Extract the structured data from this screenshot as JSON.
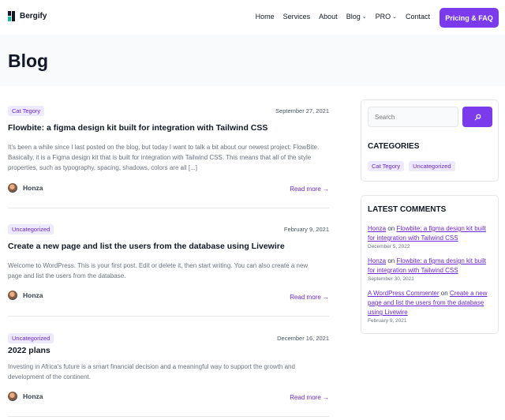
{
  "header": {
    "logo_text": "Bergify",
    "nav": [
      {
        "label": "Home",
        "has_dropdown": false
      },
      {
        "label": "Services",
        "has_dropdown": false
      },
      {
        "label": "About",
        "has_dropdown": false
      },
      {
        "label": "Blog",
        "has_dropdown": true
      },
      {
        "label": "PRO",
        "has_dropdown": true
      },
      {
        "label": "Contact",
        "has_dropdown": false
      }
    ],
    "cta_label": "Pricing & FAQ"
  },
  "page": {
    "title": "Blog"
  },
  "posts": [
    {
      "tag": "Cat Tegory",
      "date": "September 27, 2021",
      "title": "Flowbite: a figma design kit built for integration with Tailwind CSS",
      "excerpt_lines": [
        "It's been a while since I last posted on the blog, but today I want to talk a bit about our newest project: FlowBite.",
        "Basically, it is a Figma design kit that is built for integration with Tailwind CSS. This means that all of the style",
        "properties, such as typography, spacing, shadows, colors are all [...]"
      ],
      "author": "Honza",
      "read_more": "Read more →"
    },
    {
      "tag": "Uncategorized",
      "date": "February 9, 2021",
      "title": "Create a new page and list the users from the database using Livewire",
      "excerpt_lines": [
        "Welcome to WordPress. This is your first post. Edit or delete it, then start writing. You can also create a new",
        "page and list the users from the database."
      ],
      "author": "Honza",
      "read_more": "Read more →"
    },
    {
      "tag": "Uncategorized",
      "date": "December 16, 2021",
      "title": "2022 plans",
      "excerpt_lines": [
        "Investing in Africa's future is a smart financial decision and a meaningful way to support the growth and",
        "development of the continent."
      ],
      "author": "Honza",
      "read_more": "Read more →"
    }
  ],
  "sidebar": {
    "search_placeholder": "Search",
    "categories_heading": "CATEGORIES",
    "categories": [
      "Cat Tegory",
      "Uncategorized"
    ],
    "comments_heading": "LATEST COMMENTS",
    "comments": [
      {
        "author": "Honza",
        "on": "on",
        "post_lines": [
          "Flowbite: a figma design kit built",
          "for integration with Tailwind CSS"
        ],
        "date": "December 5, 2022"
      },
      {
        "author": "Honza",
        "on": "on",
        "post_lines": [
          "Flowbite: a figma design kit built",
          "for integration with Tailwind CSS"
        ],
        "date": "September 30, 2021"
      },
      {
        "author": "A WordPress Commenter",
        "on": "on",
        "post_lines": [
          "Create a new",
          "page and list the users from the database",
          "using Livewire"
        ],
        "date": "February 9, 2021"
      }
    ]
  },
  "colors": {
    "accent": "#7c3aed",
    "tag_bg": "#ede9fe",
    "tag_text": "#6d28d9",
    "band_bg": "#f9fafb"
  }
}
